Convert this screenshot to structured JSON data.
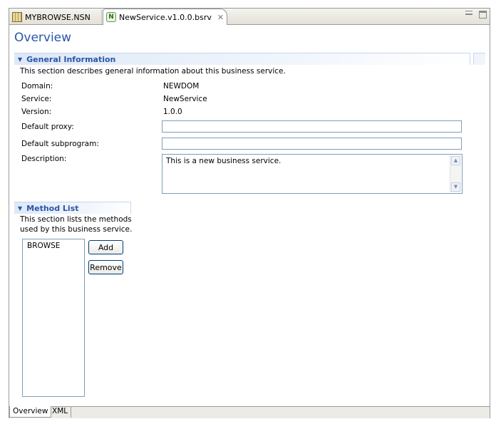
{
  "tabs": [
    {
      "label": "MYBROWSE.NSN",
      "icon": "nsn-file-icon"
    },
    {
      "label": "NewService.v1.0.0.bsrv",
      "icon": "business-service-icon",
      "close_icon": "close-icon",
      "active": true
    }
  ],
  "page_title": "Overview",
  "general": {
    "header": "General Information",
    "description": "This section describes general information about this business service.",
    "domain_label": "Domain:",
    "domain_value": "NEWDOM",
    "service_label": "Service:",
    "service_value": "NewService",
    "version_label": "Version:",
    "version_value": "1.0.0",
    "default_proxy_label": "Default proxy:",
    "default_proxy_value": "",
    "default_subprogram_label": "Default subprogram:",
    "default_subprogram_value": "",
    "description_label": "Description:",
    "description_value": "This is a new business service."
  },
  "methods": {
    "header": "Method List",
    "description_line1": "This section lists the methods",
    "description_line2": "used by this business service.",
    "items": [
      "BROWSE"
    ],
    "add_label": "Add",
    "remove_label": "Remove"
  },
  "bottom_tabs": [
    "Overview",
    "XML"
  ],
  "colors": {
    "title": "#2a56a8",
    "field_border": "#7f9db9"
  }
}
